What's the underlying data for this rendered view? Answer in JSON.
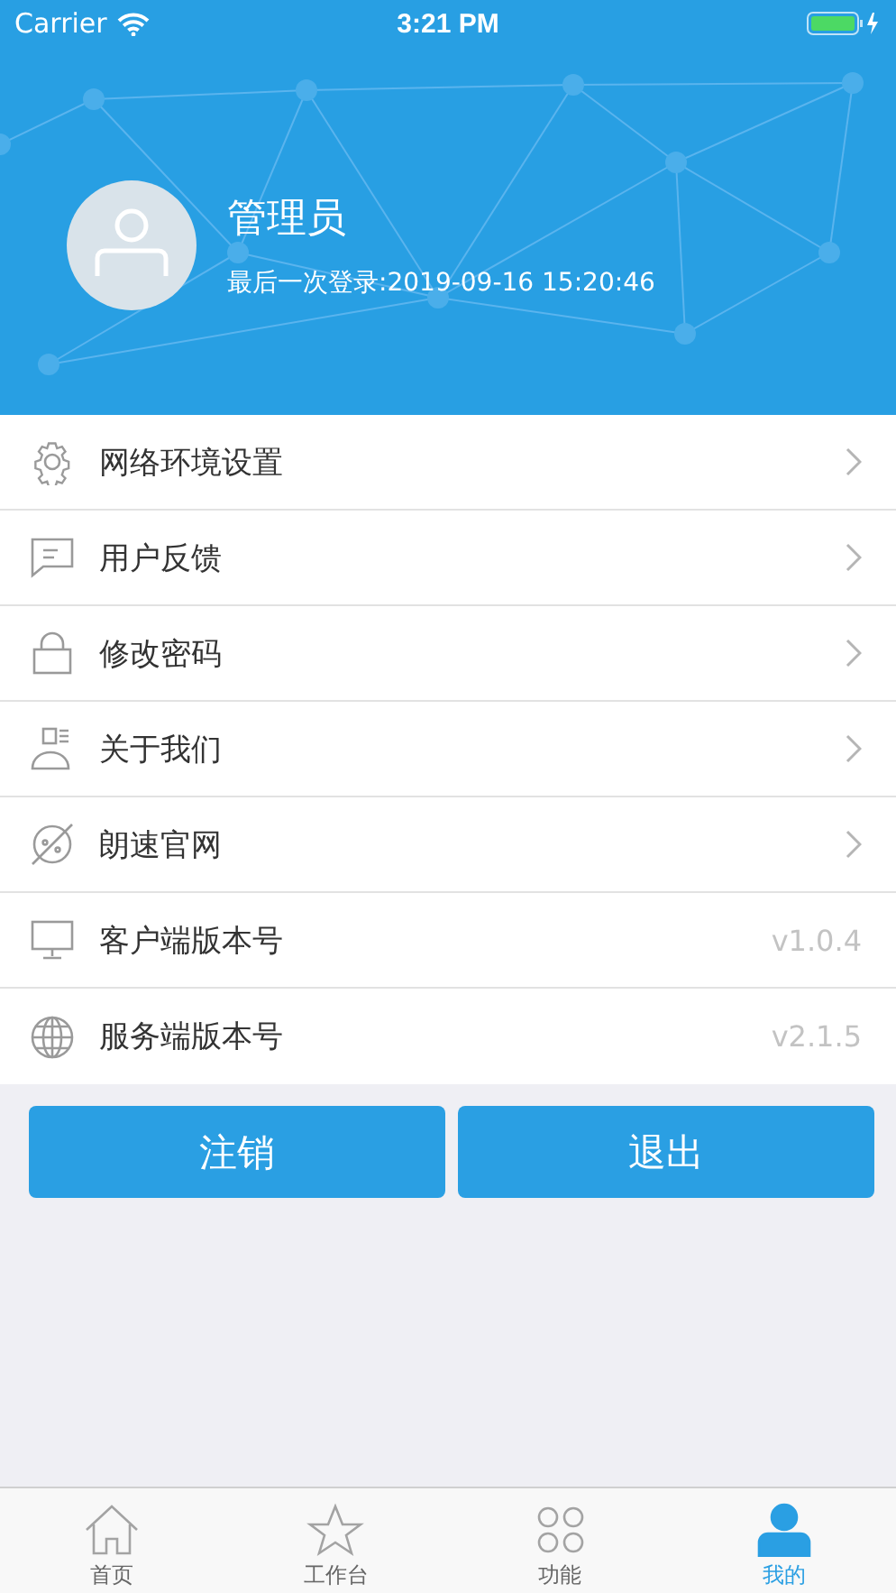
{
  "status_bar": {
    "carrier": "Carrier",
    "time": "3:21 PM"
  },
  "profile": {
    "name": "管理员",
    "last_login": "最后一次登录:2019-09-16 15:20:46"
  },
  "menu": [
    {
      "kind": "link",
      "label": "网络环境设置"
    },
    {
      "kind": "link",
      "label": "用户反馈"
    },
    {
      "kind": "link",
      "label": "修改密码"
    },
    {
      "kind": "link",
      "label": "关于我们"
    },
    {
      "kind": "link",
      "label": "朗速官网"
    },
    {
      "kind": "info",
      "label": "客户端版本号",
      "value": "v1.0.4"
    },
    {
      "kind": "info",
      "label": "服务端版本号",
      "value": "v2.1.5"
    }
  ],
  "buttons": [
    "注销",
    "退出"
  ],
  "tabs": [
    {
      "label": "首页",
      "selected": false
    },
    {
      "label": "工作台",
      "selected": false
    },
    {
      "label": "功能",
      "selected": false
    },
    {
      "label": "我的",
      "selected": true
    }
  ]
}
